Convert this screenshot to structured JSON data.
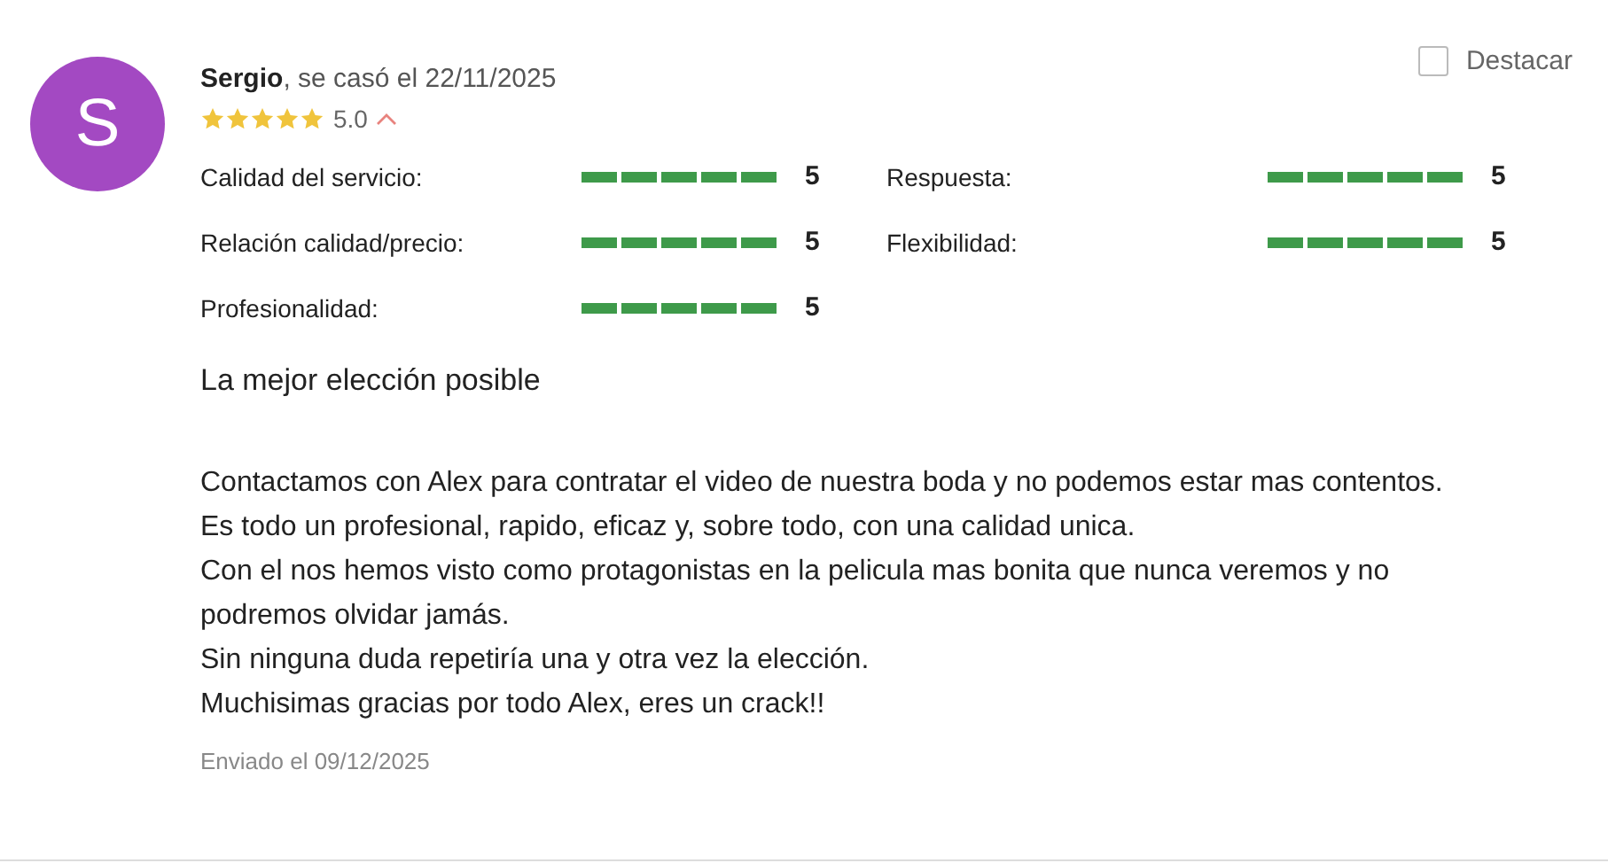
{
  "review": {
    "avatar_letter": "S",
    "author_line": "**Sergio**, se casó el 22/11/2025",
    "stars": 5,
    "score": "5.0",
    "feature": {
      "label": "Destacar",
      "checked": false
    },
    "ratings": [
      {
        "label": "Calidad del servicio:",
        "level": 1,
        "value": "5"
      },
      {
        "label": "Respuesta:",
        "level": 1,
        "value": "5"
      },
      {
        "label": "Relación calidad/precio:",
        "level": 1,
        "value": "5"
      },
      {
        "label": "Flexibilidad:",
        "level": 1,
        "value": "5"
      },
      {
        "label": "Profesionalidad:",
        "level": 1,
        "value": "5"
      }
    ],
    "title": "La mejor elección posible",
    "body": [
      "Contactamos con Alex para contratar el video de nuestra boda y no podemos estar mas contentos.",
      "Es todo un profesional, rapido, eficaz y, sobre todo, con una calidad unica.",
      "Con el nos hemos visto como protagonistas en la pelicula mas bonita que nunca veremos y no podremos olvidar jamás.",
      "Sin ninguna duda repetiría una y otra vez la elección.",
      "Muchisimas gracias por todo Alex, eres un crack!!"
    ],
    "sent": "Enviado el 09/12/2025"
  }
}
